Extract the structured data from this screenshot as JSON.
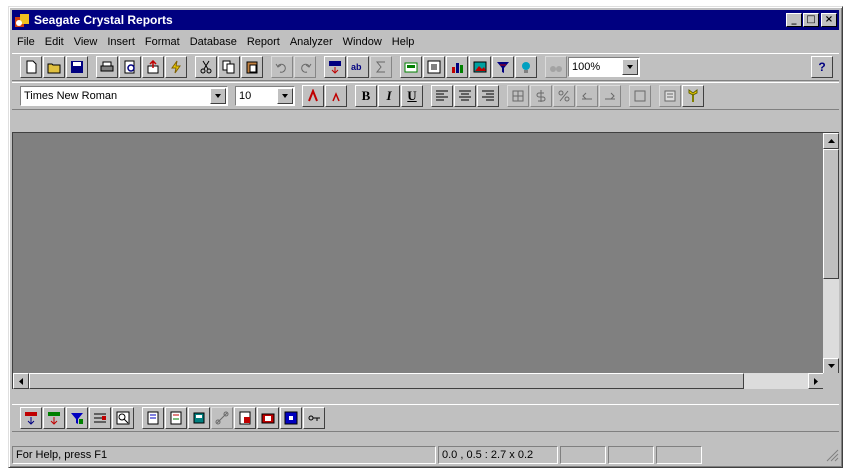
{
  "window": {
    "title": "Seagate Crystal Reports",
    "minimize_label": "_",
    "maximize_label": "□",
    "close_label": "×"
  },
  "menu": {
    "items": [
      "File",
      "Edit",
      "View",
      "Insert",
      "Format",
      "Database",
      "Report",
      "Analyzer",
      "Window",
      "Help"
    ]
  },
  "toolbar_standard": {
    "zoom_value": "100%",
    "help_label": "?"
  },
  "toolbar_format": {
    "font_name": "Times New Roman",
    "font_size": "10",
    "bold_label": "B",
    "italic_label": "I",
    "underline_label": "U"
  },
  "statusbar": {
    "help_text": "For Help, press F1",
    "position": "0.0 , 0.5 : 2.7 x 0.2"
  },
  "colors": {
    "titlebar": "#000080",
    "face": "#c0c0c0",
    "workarea": "#808080"
  }
}
